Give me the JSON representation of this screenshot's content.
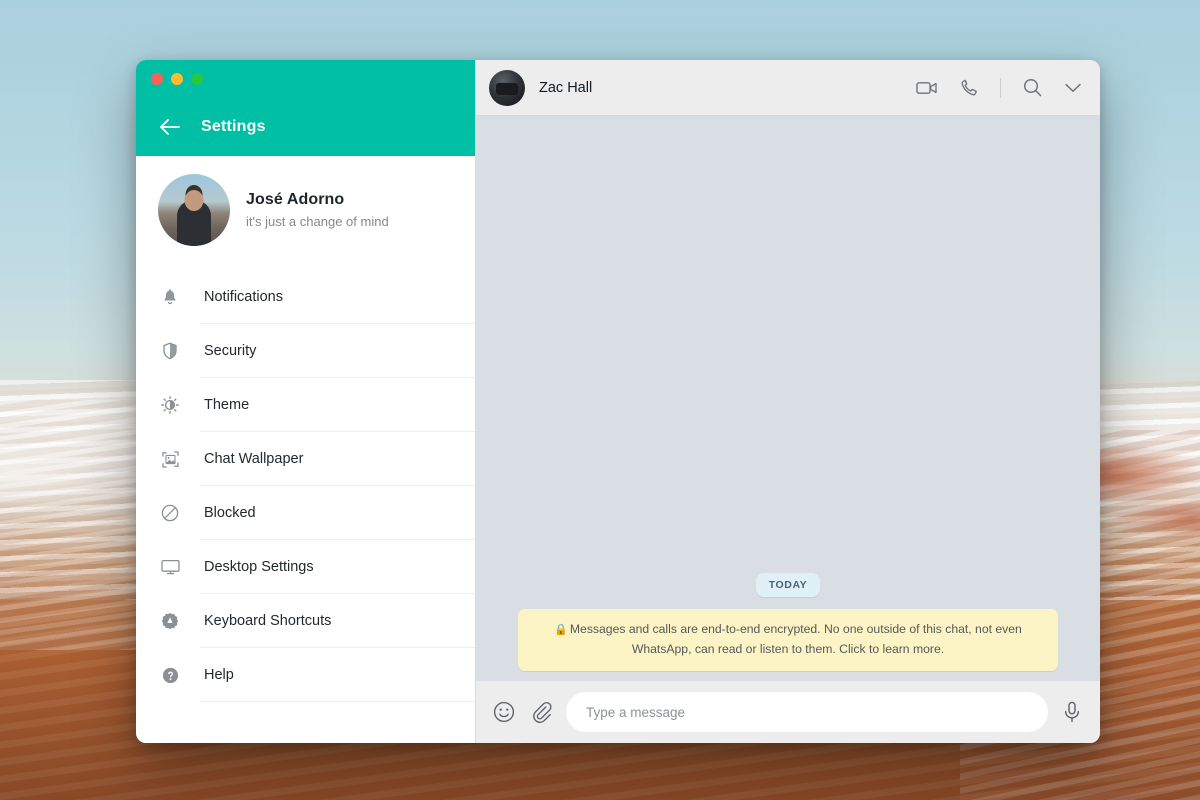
{
  "window": {
    "traffic_lights": [
      {
        "name": "close",
        "color": "#ff5f57"
      },
      {
        "name": "minimize",
        "color": "#febc2e"
      },
      {
        "name": "zoom",
        "color": "#28c840"
      }
    ]
  },
  "settings": {
    "header": {
      "title": "Settings",
      "back_icon": "back-arrow-icon",
      "accent_color": "#00bfa5"
    },
    "profile": {
      "name": "José Adorno",
      "status": "it's just a change of mind",
      "avatar": "profile-photo-avatar"
    },
    "items": [
      {
        "label": "Notifications",
        "icon": "bell-icon"
      },
      {
        "label": "Security",
        "icon": "shield-icon"
      },
      {
        "label": "Theme",
        "icon": "theme-contrast-icon"
      },
      {
        "label": "Chat Wallpaper",
        "icon": "image-frame-icon"
      },
      {
        "label": "Blocked",
        "icon": "blocked-circle-slash-icon"
      },
      {
        "label": "Desktop Settings",
        "icon": "monitor-icon"
      },
      {
        "label": "Keyboard Shortcuts",
        "icon": "keyboard-shortcut-badge-icon"
      },
      {
        "label": "Help",
        "icon": "help-question-icon"
      }
    ]
  },
  "chat": {
    "header": {
      "contact_name": "Zac Hall",
      "avatar": "contact-photo-avatar",
      "actions": [
        {
          "name": "video-call-icon"
        },
        {
          "name": "voice-call-icon"
        },
        {
          "name": "search-icon"
        },
        {
          "name": "chevron-down-icon"
        }
      ]
    },
    "body": {
      "date_divider": "TODAY",
      "encryption_notice": "Messages and calls are end-to-end encrypted. No one outside of this chat, not even WhatsApp, can read or listen to them. Click to learn more.",
      "encryption_lock_icon": "lock-icon",
      "background_color": "#d9dee5"
    },
    "footer": {
      "emoji_icon": "smiley-icon",
      "attach_icon": "paperclip-icon",
      "input_placeholder": "Type a message",
      "input_value": "",
      "mic_icon": "microphone-icon"
    }
  }
}
